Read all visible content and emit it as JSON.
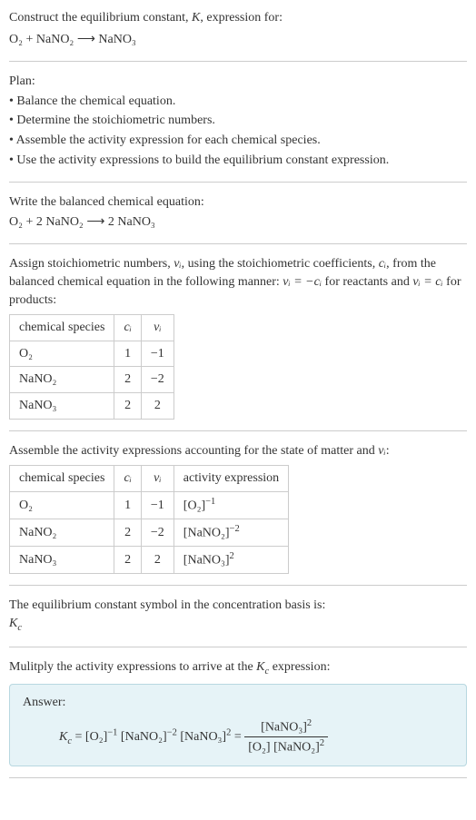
{
  "header": {
    "title_prefix": "Construct the equilibrium constant, ",
    "title_k": "K",
    "title_suffix": ", expression for:",
    "equation": "O₂ + NaNO₂ ⟶ NaNO₃"
  },
  "plan": {
    "heading": "Plan:",
    "items": [
      "• Balance the chemical equation.",
      "• Determine the stoichiometric numbers.",
      "• Assemble the activity expression for each chemical species.",
      "• Use the activity expressions to build the equilibrium constant expression."
    ]
  },
  "balanced": {
    "heading": "Write the balanced chemical equation:",
    "equation": "O₂ + 2 NaNO₂ ⟶ 2 NaNO₃"
  },
  "stoich": {
    "text_a": "Assign stoichiometric numbers, ",
    "nu_i": "νᵢ",
    "text_b": ", using the stoichiometric coefficients, ",
    "c_i": "cᵢ",
    "text_c": ", from the balanced chemical equation in the following manner: ",
    "rel1": "νᵢ = −cᵢ",
    "text_d": " for reactants and ",
    "rel2": "νᵢ = cᵢ",
    "text_e": " for products:",
    "headers": [
      "chemical species",
      "cᵢ",
      "νᵢ"
    ],
    "rows": [
      [
        "O₂",
        "1",
        "−1"
      ],
      [
        "NaNO₂",
        "2",
        "−2"
      ],
      [
        "NaNO₃",
        "2",
        "2"
      ]
    ]
  },
  "activity": {
    "heading_a": "Assemble the activity expressions accounting for the state of matter and ",
    "heading_b": ":",
    "headers": [
      "chemical species",
      "cᵢ",
      "νᵢ",
      "activity expression"
    ],
    "rows": [
      {
        "sp": "O₂",
        "c": "1",
        "nu": "−1",
        "base": "[O₂]",
        "exp": "−1"
      },
      {
        "sp": "NaNO₂",
        "c": "2",
        "nu": "−2",
        "base": "[NaNO₂]",
        "exp": "−2"
      },
      {
        "sp": "NaNO₃",
        "c": "2",
        "nu": "2",
        "base": "[NaNO₃]",
        "exp": "2"
      }
    ]
  },
  "symbol": {
    "text": "The equilibrium constant symbol in the concentration basis is:",
    "kc": "K",
    "kc_sub": "c"
  },
  "final": {
    "heading_a": "Mulitply the activity expressions to arrive at the ",
    "heading_b": " expression:",
    "answer_label": "Answer:",
    "kc": "K",
    "kc_sub": "c",
    "eq": " = ",
    "t1_base": "[O₂]",
    "t1_exp": "−1",
    "t2_base": "[NaNO₂]",
    "t2_exp": "−2",
    "t3_base": "[NaNO₃]",
    "t3_exp": "2",
    "eq2": " = ",
    "num_base": "[NaNO₃]",
    "num_exp": "2",
    "den1": "[O₂]",
    "den2_base": "[NaNO₂]",
    "den2_exp": "2"
  }
}
